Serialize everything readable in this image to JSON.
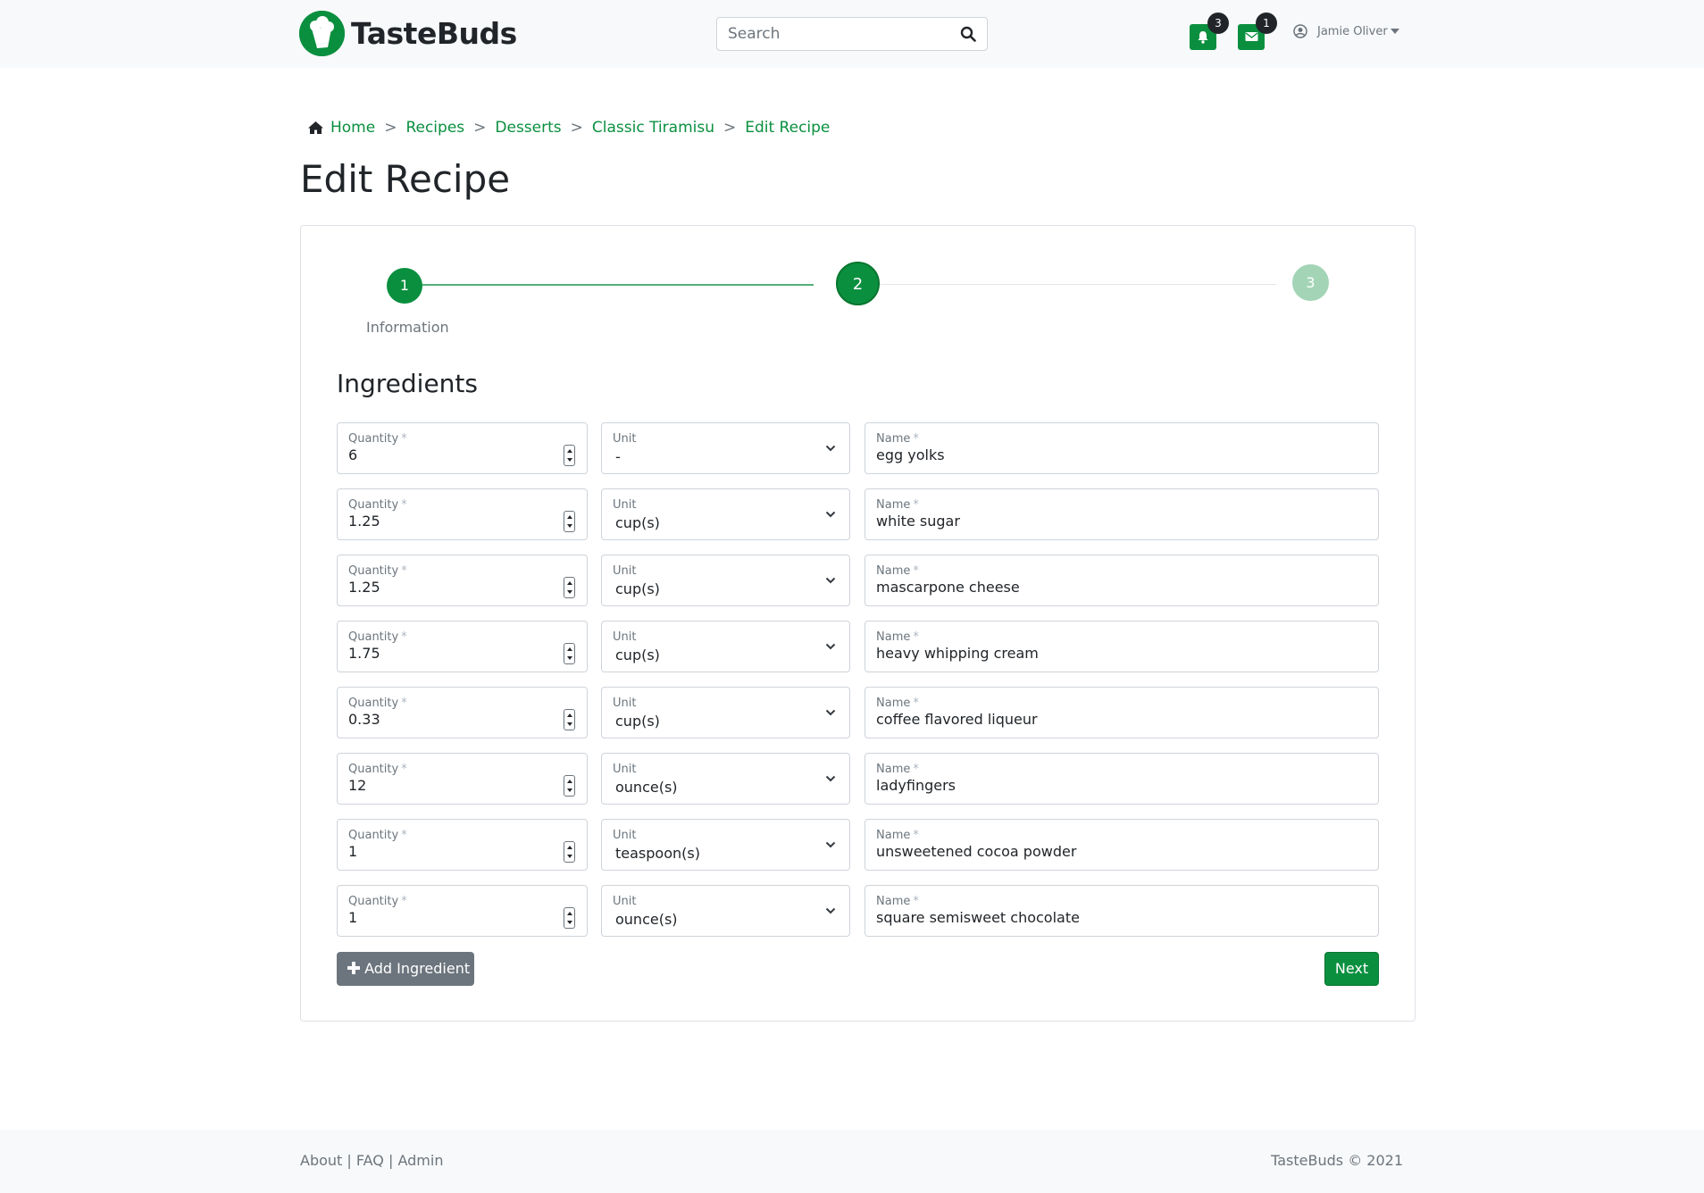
{
  "navbar": {
    "brand_name": "TasteBuds",
    "search_placeholder": "Search",
    "notifications_count": "3",
    "messages_count": "1",
    "user_name": "Jamie Oliver"
  },
  "breadcrumb": [
    "Home",
    "Recipes",
    "Desserts",
    "Classic Tiramisu",
    "Edit Recipe"
  ],
  "page_title": "Edit Recipe",
  "stepper": {
    "steps": [
      "1",
      "2",
      "3"
    ],
    "label": "Information"
  },
  "section_title": "Ingredients",
  "labels": {
    "quantity": "Quantity",
    "unit": "Unit",
    "name": "Name",
    "required": "*"
  },
  "ingredients": [
    {
      "quantity": "6",
      "unit": "-",
      "name": "egg yolks"
    },
    {
      "quantity": "1.25",
      "unit": "cup(s)",
      "name": "white sugar"
    },
    {
      "quantity": "1.25",
      "unit": "cup(s)",
      "name": "mascarpone cheese"
    },
    {
      "quantity": "1.75",
      "unit": "cup(s)",
      "name": "heavy whipping cream"
    },
    {
      "quantity": "0.33",
      "unit": "cup(s)",
      "name": "coffee flavored liqueur"
    },
    {
      "quantity": "12",
      "unit": "ounce(s)",
      "name": "ladyfingers"
    },
    {
      "quantity": "1",
      "unit": "teaspoon(s)",
      "name": "unsweetened cocoa powder"
    },
    {
      "quantity": "1",
      "unit": "ounce(s)",
      "name": "square semisweet chocolate"
    }
  ],
  "buttons": {
    "add_ingredient": "Add Ingredient",
    "next": "Next"
  },
  "footer": {
    "about": "About",
    "faq": "FAQ",
    "admin": "Admin",
    "separator": "|",
    "copyright": "TasteBuds © 2021"
  },
  "colors": {
    "primary": "#0a8f3f",
    "secondary": "#6c757d",
    "step_inactive": "#a3d4b6"
  }
}
